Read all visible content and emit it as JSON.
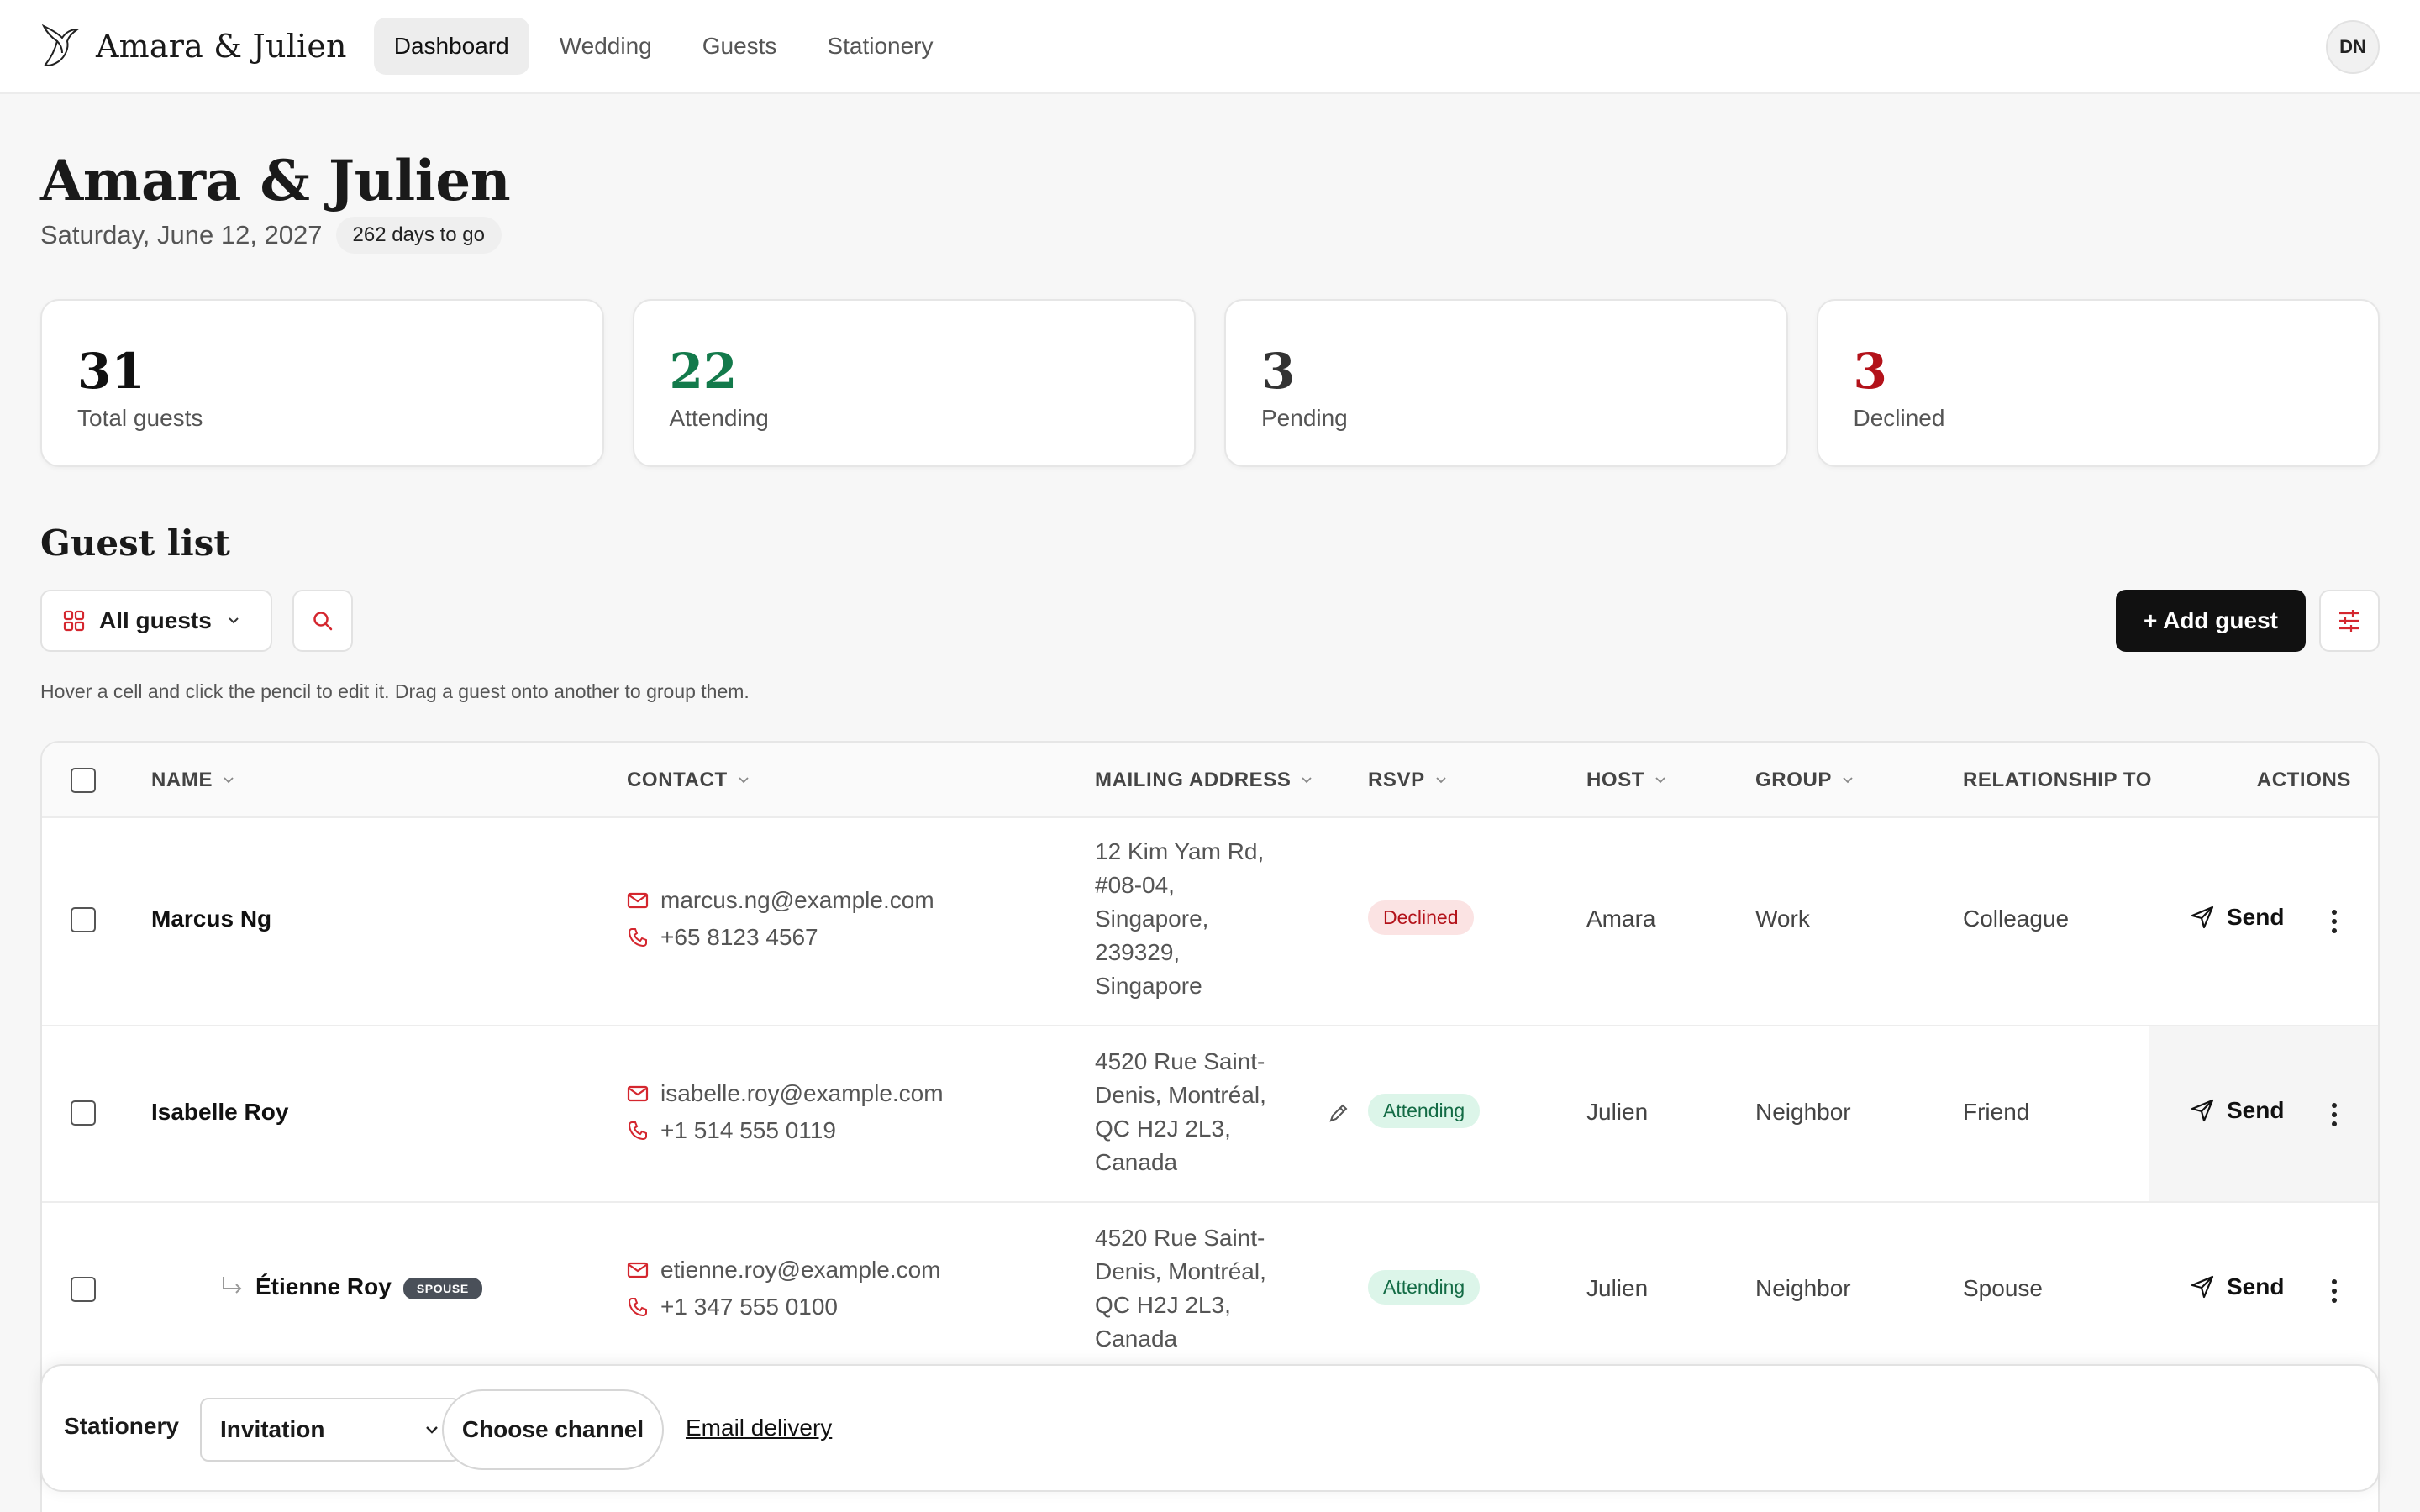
{
  "brand": {
    "name": "Amara & Julien"
  },
  "nav": {
    "items": [
      {
        "label": "Dashboard",
        "active": true
      },
      {
        "label": "Wedding"
      },
      {
        "label": "Guests"
      },
      {
        "label": "Stationery"
      }
    ]
  },
  "user": {
    "initials": "DN"
  },
  "header": {
    "title": "Amara & Julien",
    "date": "Saturday, June 12, 2027",
    "countdown": "262 days to go"
  },
  "stats": [
    {
      "value": "31",
      "label": "Total guests",
      "color": "#111111"
    },
    {
      "value": "22",
      "label": "Attending",
      "color": "#137a4b"
    },
    {
      "value": "3",
      "label": "Pending",
      "color": "#333333"
    },
    {
      "value": "3",
      "label": "Declined",
      "color": "#b3121a"
    }
  ],
  "guest_list": {
    "title": "Guest list",
    "filter_label": "All guests",
    "add_label": "+ Add guest",
    "hint": "Hover a cell and click the pencil to edit it. Drag a guest onto another to group them.",
    "columns": {
      "name": "NAME",
      "contact": "CONTACT",
      "address": "MAILING ADDRESS",
      "rsvp": "RSVP",
      "host": "HOST",
      "group": "GROUP",
      "relationship": "RELATIONSHIP TO",
      "actions": "ACTIONS"
    },
    "send_label": "Send",
    "spouse_label": "SPOUSE",
    "rows": [
      {
        "name": "Marcus Ng",
        "email": "marcus.ng@example.com",
        "phone": "+65 8123 4567",
        "address": [
          "12 Kim Yam Rd,",
          "#08-04,",
          "Singapore,",
          "239329,",
          "Singapore"
        ],
        "rsvp": "Declined",
        "host": "Amara",
        "group": "Work",
        "relationship": "Colleague"
      },
      {
        "name": "Isabelle Roy",
        "email": "isabelle.roy@example.com",
        "phone": "+1 514 555 0119",
        "address": [
          "4520 Rue Saint-",
          "Denis, Montréal,",
          "QC H2J 2L3,",
          "Canada"
        ],
        "rsvp": "Attending",
        "host": "Julien",
        "group": "Neighbor",
        "relationship": "Friend"
      },
      {
        "name": "Étienne Roy",
        "email": "etienne.roy@example.com",
        "phone": "+1 347 555 0100",
        "address": [
          "4520 Rue Saint-",
          "Denis, Montréal,",
          "QC H2J 2L3,",
          "Canada"
        ],
        "rsvp": "Attending",
        "host": "Julien",
        "group": "Neighbor",
        "relationship": "Spouse"
      }
    ]
  },
  "bottom_bar": {
    "label": "Stationery",
    "select_value": "Invitation",
    "channel_label": "Choose channel",
    "link_label": "Email delivery"
  }
}
